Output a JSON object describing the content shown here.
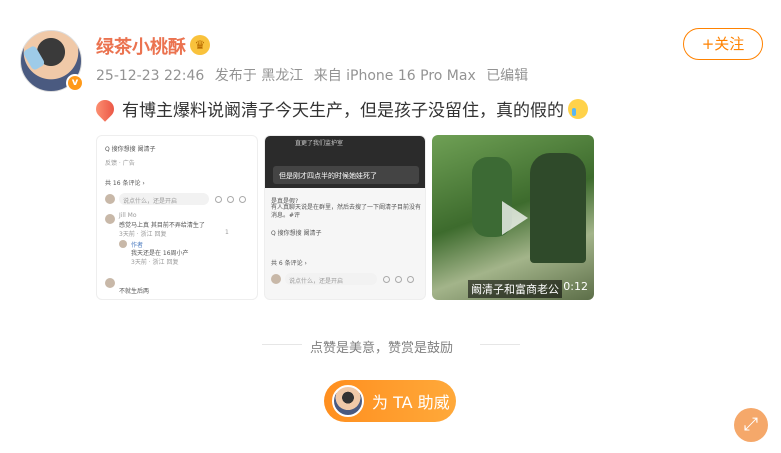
{
  "user": {
    "name": "绿茶小桃酥",
    "verified_badge": "v",
    "meta": {
      "date": "25-12-23 22:46",
      "location": "发布于 黑龙江",
      "source": "来自 iPhone 16 Pro Max",
      "edited": "已编辑"
    },
    "follow_label": "+关注"
  },
  "post": {
    "text": "有博主爆料说阚清子今天生产，但是孩子没留住，真的假的"
  },
  "images": {
    "img1": {
      "search": "Q 搜你想搜  阚清子",
      "ad": "反馈 · 广告",
      "comments_count": "共 16 条评论 ›",
      "input_placeholder": "说点什么，还是开启",
      "comment1_user": "Jill Mo",
      "comment1_text": "感觉马上真 其目前不弄给清生了",
      "comment1_meta": "3天前 · 浙江   回复",
      "reply_user": "作者",
      "reply_text": "我天还是在 16周小产",
      "reply_meta": "3天前 · 浙江   回复",
      "comment2_text": "不就生后两",
      "like_count": "1"
    },
    "img2": {
      "top_text": "直更了我们监护室",
      "chat_text": "但是刚才四点半的时候她娃死了",
      "q_text": "是真是假?",
      "body_text": "有人真聊天说是在群里，然后去搜了一下阚清子目前没有消息。#评",
      "search": "Q 搜你想搜  阚清子",
      "comments_count": "共 6 条评论 ›",
      "input_placeholder": "说点什么，还是开启"
    },
    "img3": {
      "caption": "阚清子和富商老公",
      "duration": "0:12"
    }
  },
  "footer": {
    "slogan": "点赞是美意，赞赏是鼓励",
    "tip_label": "为 TA 助威"
  },
  "icons": {
    "follow": "plus-icon",
    "expand": "expand-arrows-icon",
    "play": "play-icon"
  },
  "colors": {
    "accent": "#ff8200",
    "username": "#eb7350",
    "meta": "#939393"
  }
}
